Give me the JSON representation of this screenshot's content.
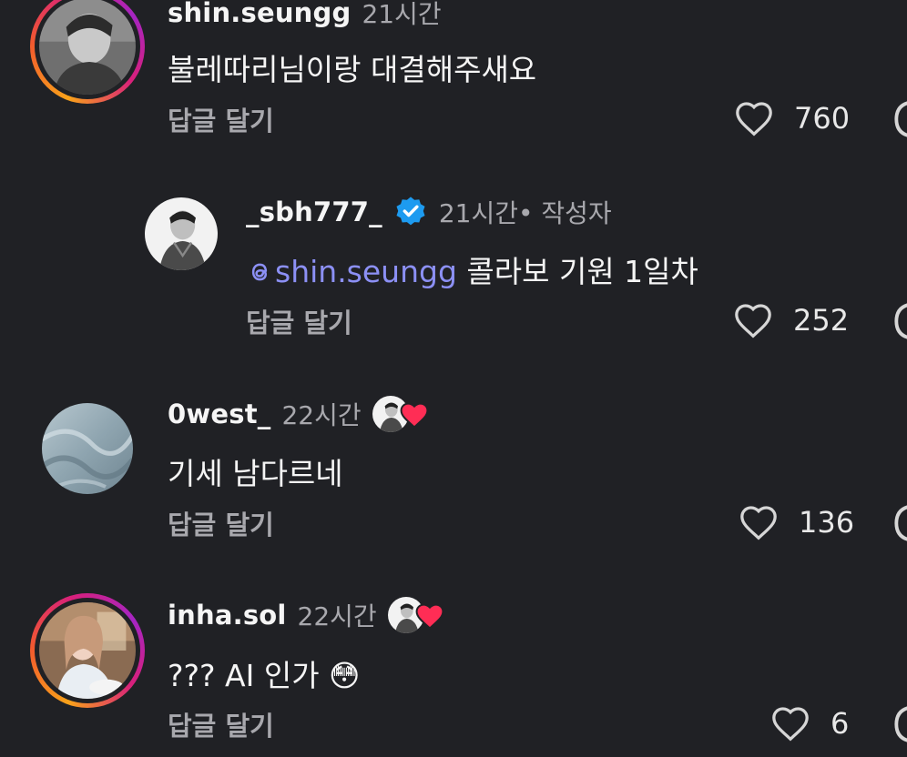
{
  "comments": [
    {
      "username": "shin.seungg",
      "time": "21시간",
      "text": "불레따리님이랑 대결해주새요",
      "reply_label": "답글 달기",
      "like_count": "760",
      "avatar_ring": true
    },
    {
      "username": "_sbh777_",
      "time": "21시간",
      "author_tag": " • 작성자",
      "verified": true,
      "mention": "shin.seungg",
      "text": " 콜라보 기원 1일차",
      "reply_label": "답글 달기",
      "like_count": "252",
      "avatar_ring": false
    },
    {
      "username": "0west_",
      "time": "22시간",
      "liked_by_author": true,
      "text": "기세 남다르네",
      "reply_label": "답글 달기",
      "like_count": "136",
      "avatar_ring": false
    },
    {
      "username": "inha.sol",
      "time": "22시간",
      "liked_by_author": true,
      "text": "??? AI 인가 😳",
      "reply_label": "답글 달기",
      "like_count": "6",
      "avatar_ring": true
    }
  ],
  "icons": {
    "like": "heart-outline-icon",
    "verified": "verified-badge-icon",
    "author_like": "red-heart-icon",
    "mention": "threads-icon"
  },
  "colors": {
    "background": "#202125",
    "mention": "#8c90f5",
    "verified": "#1d9bf0",
    "heart": "#ff2d55",
    "muted_text": "#a8a8ad"
  }
}
